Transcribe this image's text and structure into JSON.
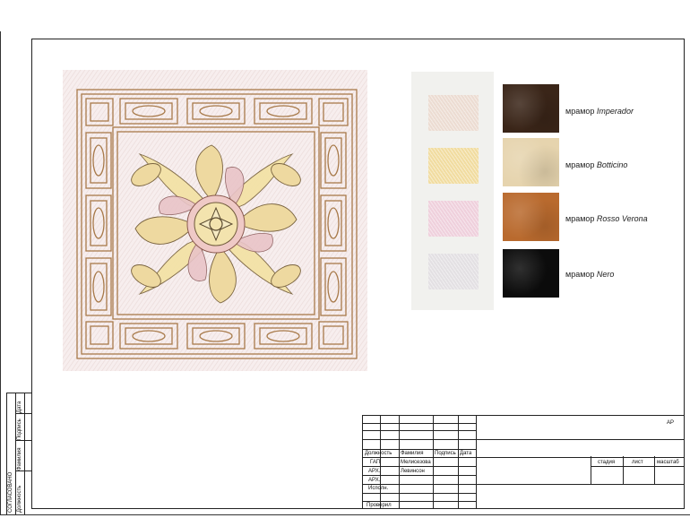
{
  "stamp": {
    "header": "СОГЛАСОВАНО",
    "cols": [
      "Должность",
      "Фамилия",
      "Подпись",
      "Дата"
    ]
  },
  "materials": [
    {
      "prefix": "мрамор",
      "name": "Imperador",
      "color": "#3a2518"
    },
    {
      "prefix": "мрамор",
      "name": "Botticino",
      "color": "#e6d4ae"
    },
    {
      "prefix": "мрамор",
      "name": "Rosso Verona",
      "color": "#b96a2e"
    },
    {
      "prefix": "мрамор",
      "name": "Nero",
      "color": "#0c0c0c"
    }
  ],
  "pencil_swatches": [
    {
      "color": "#ecdcd2"
    },
    {
      "color": "#f1dca0"
    },
    {
      "color": "#efd0dc"
    },
    {
      "color": "#e3e0e3"
    }
  ],
  "title_block": {
    "project_code": "АР",
    "headers": [
      "Должность",
      "Фамилия",
      "Подпись",
      "Дата"
    ],
    "rows": [
      {
        "role": "ГАП",
        "name": "Мелисезова"
      },
      {
        "role": "АРХ.",
        "name": "Левинсон"
      },
      {
        "role": "АРХ.",
        "name": ""
      },
      {
        "role": "Исполн.",
        "name": ""
      },
      {
        "role": "Проверил",
        "name": ""
      }
    ],
    "stage_label": "стадия",
    "sheet_label": "лист",
    "scale_label": "масштаб"
  }
}
